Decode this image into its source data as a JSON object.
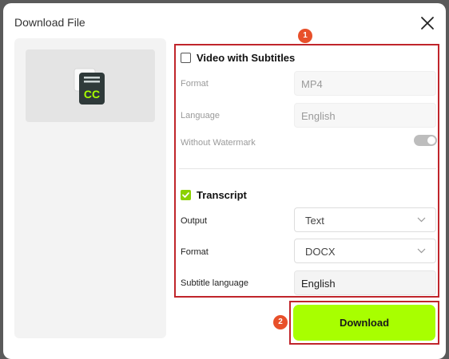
{
  "dialog": {
    "title": "Download File"
  },
  "badges": {
    "options": "1",
    "download": "2"
  },
  "video_section": {
    "title": "Video with Subtitles",
    "checked": false,
    "format_label": "Format",
    "format_value": "MP4",
    "language_label": "Language",
    "language_value": "English",
    "watermark_label": "Without Watermark"
  },
  "transcript_section": {
    "title": "Transcript",
    "checked": true,
    "output_label": "Output",
    "output_value": "Text",
    "format_label": "Format",
    "format_value": "DOCX",
    "subtitle_language_label": "Subtitle language",
    "subtitle_language_value": "English"
  },
  "actions": {
    "download_label": "Download"
  },
  "colors": {
    "accent_green": "#a8ff00",
    "checkbox_green": "#8bd100",
    "highlight_red": "#c0252b",
    "badge_orange": "#e8502a"
  },
  "icons": {
    "close": "close-icon",
    "file": "subtitle-file-icon",
    "chevron": "chevron-down-icon"
  }
}
